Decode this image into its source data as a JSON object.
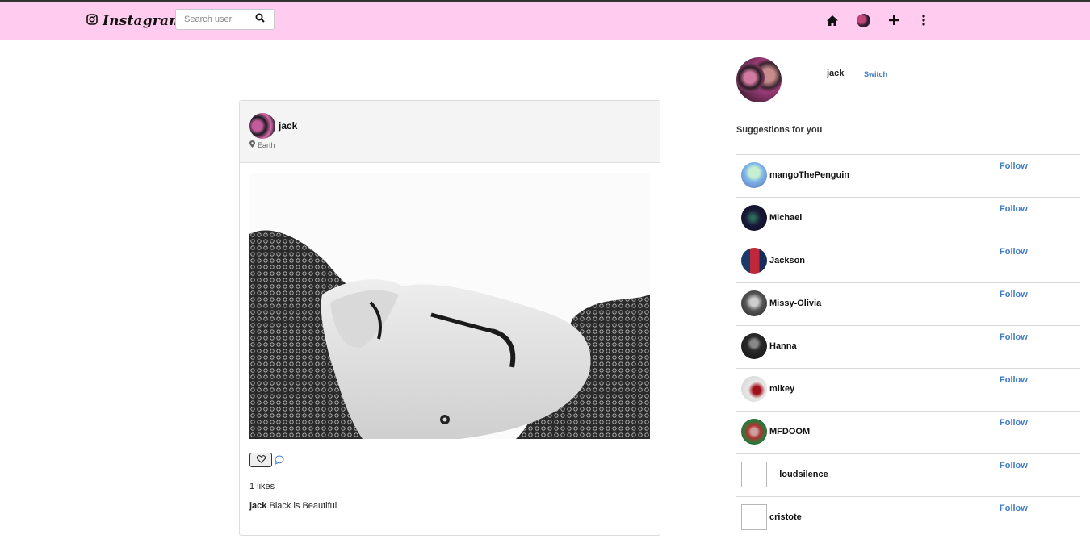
{
  "navbar": {
    "brand": "Instagram",
    "search_placeholder": "Search user",
    "background": "#ffcbee",
    "icons": [
      "instagram-logo-icon",
      "search-icon",
      "home-icon",
      "profile-avatar",
      "plus-icon",
      "more-vertical-icon"
    ]
  },
  "post": {
    "username": "jack",
    "location": "Earth",
    "likes": "1 likes",
    "caption_user": "jack",
    "caption_text": "Black is Beautiful",
    "image_description_icon": "post-photo"
  },
  "sidebar": {
    "current_user": "jack",
    "switch_label": "Switch",
    "suggestions_title": "Suggestions for you",
    "accent": "#3f7bc8",
    "suggestions": [
      {
        "name": "mangoThePenguin",
        "follow": "Follow",
        "avatar_color": "#7fb7e8"
      },
      {
        "name": "Michael",
        "follow": "Follow",
        "avatar_color": "#1a1a3a"
      },
      {
        "name": "Jackson",
        "follow": "Follow",
        "avatar_color": "#c0283a"
      },
      {
        "name": "Missy-Olivia",
        "follow": "Follow",
        "avatar_color": "#555555"
      },
      {
        "name": "Hanna",
        "follow": "Follow",
        "avatar_color": "#2a2a2a"
      },
      {
        "name": "mikey",
        "follow": "Follow",
        "avatar_color": "#d8d8d8"
      },
      {
        "name": "MFDOOM",
        "follow": "Follow",
        "avatar_color": "#2f7a3a"
      },
      {
        "name": "__loudsilence",
        "follow": "Follow",
        "avatar_color": "broken"
      },
      {
        "name": "cristote",
        "follow": "Follow",
        "avatar_color": "broken"
      }
    ]
  }
}
